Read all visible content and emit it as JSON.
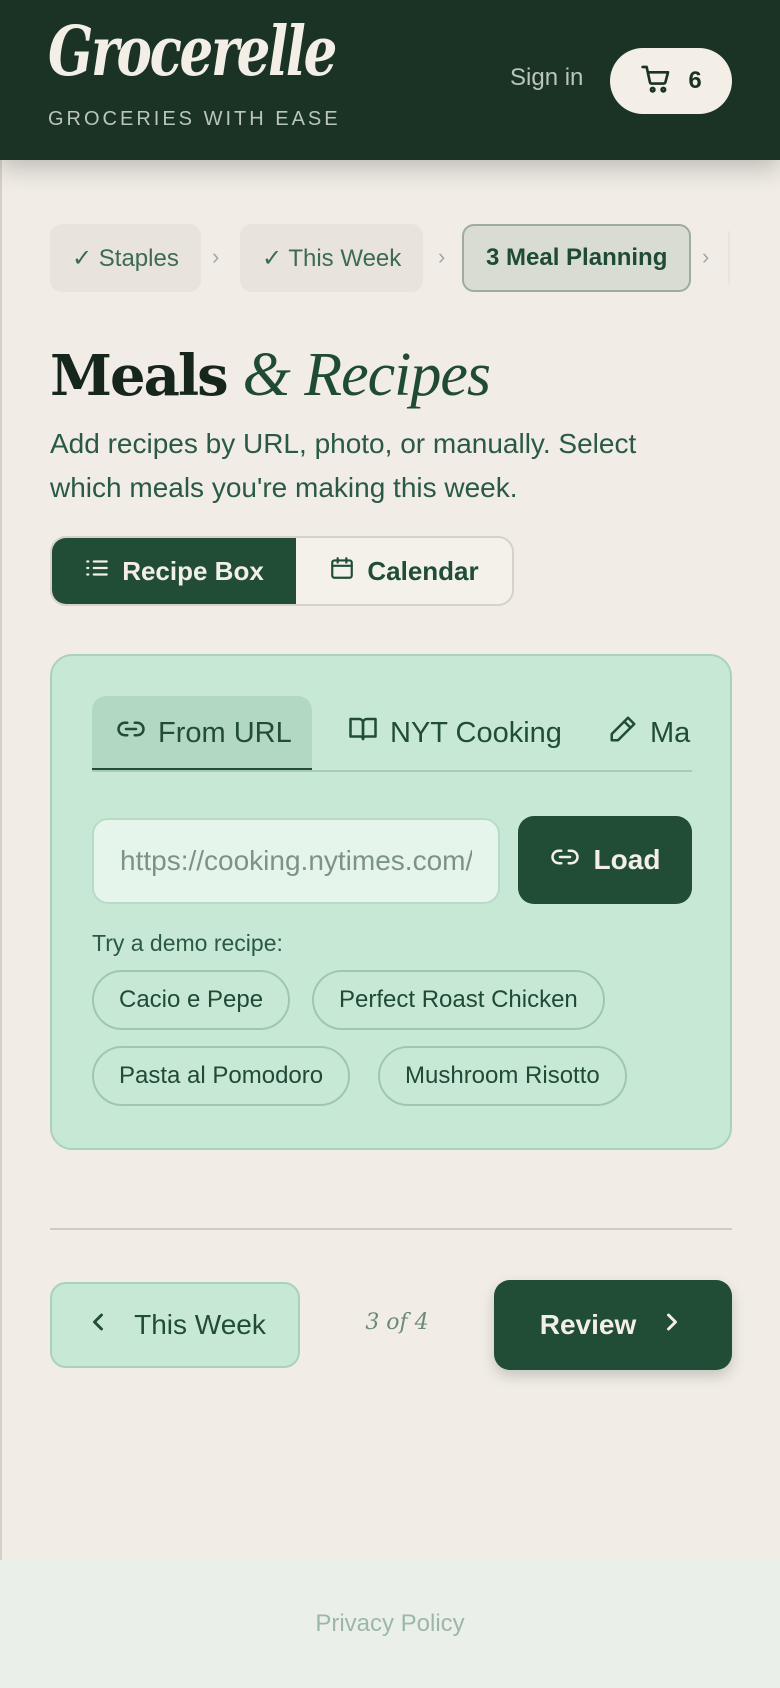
{
  "header": {
    "logo": "Grocerelle",
    "tagline": "GROCERIES WITH EASE",
    "signin_label": "Sign in",
    "cart_icon": "cart-icon",
    "cart_count": "6"
  },
  "steps": [
    {
      "label": "✓ Staples",
      "state": "done"
    },
    {
      "label": "✓ This Week",
      "state": "done"
    },
    {
      "label": "3 Meal Planning",
      "state": "active"
    }
  ],
  "page": {
    "title_strong": "Meals",
    "title_em": "& Recipes",
    "subtitle": "Add recipes by URL, photo, or manually. Select which meals you're making this week."
  },
  "view_toggle": {
    "recipe_box": "Recipe Box",
    "calendar": "Calendar",
    "selected": "Recipe Box"
  },
  "source_tabs": {
    "from_url": "From URL",
    "nyt": "NYT Cooking",
    "manual": "Manual",
    "selected": "From URL"
  },
  "url_input": {
    "placeholder": "https://cooking.nytimes.com/...",
    "value": ""
  },
  "load_label": "Load",
  "demo": {
    "label": "Try a demo recipe:",
    "recipes": [
      "Cacio e Pepe",
      "Perfect Roast Chicken",
      "Pasta al Pomodoro",
      "Mushroom Risotto"
    ]
  },
  "nav": {
    "back_label": "This Week",
    "page_indicator": "3 of 4",
    "next_label": "Review"
  },
  "footer": {
    "privacy": "Privacy Policy"
  },
  "colors": {
    "header_bg": "#1b3325",
    "page_bg": "#f1ede6",
    "accent": "#214d36",
    "card_bg": "#c8e8d6"
  }
}
